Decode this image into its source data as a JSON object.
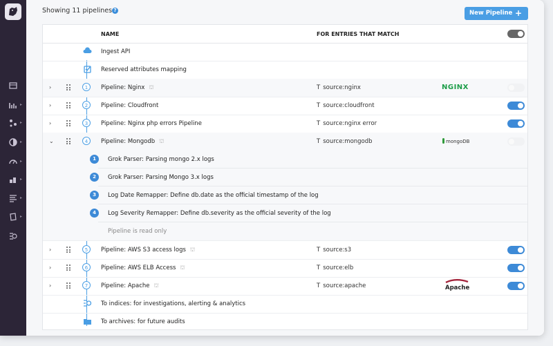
{
  "header": {
    "showing_text": "Showing 11 pipelines",
    "help_glyph": "?",
    "new_pipeline_label": "New Pipeline",
    "new_pipeline_plus": "+"
  },
  "table": {
    "col_name": "NAME",
    "col_filter": "FOR ENTRIES THAT MATCH",
    "header_toggle": "gray",
    "rows": [
      {
        "name": "Ingest API",
        "icon": "cloud-icon"
      },
      {
        "name": "Reserved attributes mapping",
        "icon": "checkbox-icon"
      },
      {
        "num": "1",
        "name": "Pipeline: Nginx",
        "filter_type": "T",
        "filter": "source:nginx",
        "logo": "NGINX",
        "toggle": "off",
        "read_only": true
      },
      {
        "num": "2",
        "name": "Pipeline: Cloudfront",
        "filter_type": "T",
        "filter": "source:cloudfront",
        "toggle": "on"
      },
      {
        "num": "3",
        "name": "Pipeline: Nginx php errors Pipeline",
        "filter_type": "T",
        "filter": "source:nginx error",
        "toggle": "on"
      },
      {
        "num": "4",
        "name": "Pipeline: Mongodb",
        "filter_type": "T",
        "filter": "source:mongodb",
        "logo": "mongoDB",
        "toggle": "off",
        "read_only": true,
        "expanded": true,
        "processors": [
          {
            "num": "1",
            "name": "Grok Parser: Parsing mongo 2.x logs"
          },
          {
            "num": "2",
            "name": "Grok Parser: Parsing Mongo 3.x logs"
          },
          {
            "num": "3",
            "name": "Log Date Remapper: Define db.date as the official timestamp of the log"
          },
          {
            "num": "4",
            "name": "Log Severity Remapper: Define db.severity as the official severity of the log"
          }
        ],
        "read_only_note": "Pipeline is read only"
      },
      {
        "num": "5",
        "name": "Pipeline: AWS S3 access logs",
        "filter_type": "T",
        "filter": "source:s3",
        "toggle": "on",
        "read_only": true
      },
      {
        "num": "6",
        "name": "Pipeline: AWS ELB Access",
        "filter_type": "T",
        "filter": "source:elb",
        "toggle": "on",
        "read_only": true
      },
      {
        "num": "7",
        "name": "Pipeline: Apache",
        "filter_type": "T",
        "filter": "source:apache",
        "logo": "Apache",
        "toggle": "on",
        "read_only": true
      },
      {
        "name": "To indices: for investigations, alerting & analytics",
        "icon": "indices-icon"
      },
      {
        "name": "To archives: for future audits",
        "icon": "folder-icon"
      }
    ]
  },
  "colors": {
    "sidebar": "#2c2537",
    "accent": "#4a9ee4",
    "toggle_on": "#3d8ad7",
    "nginx": "#1c9d48"
  }
}
